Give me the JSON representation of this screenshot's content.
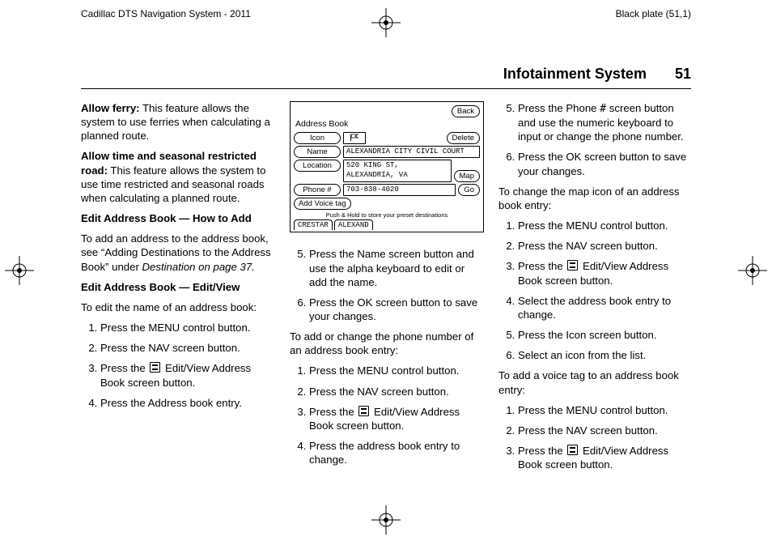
{
  "meta": {
    "top_left": "Cadillac DTS Navigation System - 2011",
    "top_right": "Black plate (51,1)"
  },
  "header": {
    "title": "Infotainment System",
    "page": "51"
  },
  "col1": {
    "allow_ferry_label": "Allow ferry:",
    "allow_ferry_text": "  This feature allows the system to use ferries when calculating a planned route.",
    "allow_time_label": "Allow time and seasonal restricted road:",
    "allow_time_text": "  This feature allows the system to use time restricted and seasonal roads when calculating a planned route.",
    "how_to_add_head": "Edit Address Book — How to Add",
    "how_to_add_text_a": "To add an address to the address book, see “Adding Destinations to the Address Book” under ",
    "how_to_add_text_b": "Destination on page 37.",
    "edit_view_head": "Edit Address Book — Edit/View",
    "edit_view_intro": "To edit the name of an address book:",
    "steps": {
      "s1": "Press the MENU control button.",
      "s2": "Press the NAV screen button.",
      "s3a": "Press the ",
      "s3b": " Edit/View Address Book screen button.",
      "s4": "Press the Address book entry."
    }
  },
  "addrbook": {
    "title": "Address Book",
    "back": "Back",
    "icon_label": "Icon",
    "delete": "Delete",
    "name_label": "Name",
    "name_val": "ALEXANDRIA CITY CIVIL COURT",
    "location_label": "Location",
    "location_val": "520 KING ST,\nALEXANDRIA, VA",
    "map": "Map",
    "phone_label": "Phone #",
    "phone_val": "703-838-4020",
    "go": "Go",
    "voice": "Add Voice tag",
    "hint": "Push & Hold to store your preset destinations",
    "p1": "CRESTAR",
    "p2": "ALEXAND"
  },
  "col2": {
    "s5": "Press the Name screen button and use the alpha keyboard to edit or add the name.",
    "s6": "Press the OK screen button to save your changes.",
    "phone_intro": "To add or change the phone number of an address book entry:",
    "p1": "Press the MENU control button.",
    "p2": "Press the NAV screen button.",
    "p3a": "Press the ",
    "p3b": " Edit/View Address Book screen button.",
    "p4": "Press the address book entry to change."
  },
  "col3": {
    "s5a": "Press the Phone ",
    "s5b": " screen button and use the numeric keyboard to input or change the phone number.",
    "s6": "Press the OK screen button to save your changes.",
    "icon_intro": "To change the map icon of an address book entry:",
    "i1": "Press the MENU control button.",
    "i2": "Press the NAV screen button.",
    "i3a": "Press the ",
    "i3b": " Edit/View Address Book screen button.",
    "i4": "Select the address book entry to change.",
    "i5": "Press the Icon screen button.",
    "i6": "Select an icon from the list.",
    "voice_intro": "To add a voice tag to an address book entry:",
    "v1": "Press the MENU control button.",
    "v2": "Press the NAV screen button.",
    "v3a": "Press the ",
    "v3b": " Edit/View Address Book screen button."
  }
}
